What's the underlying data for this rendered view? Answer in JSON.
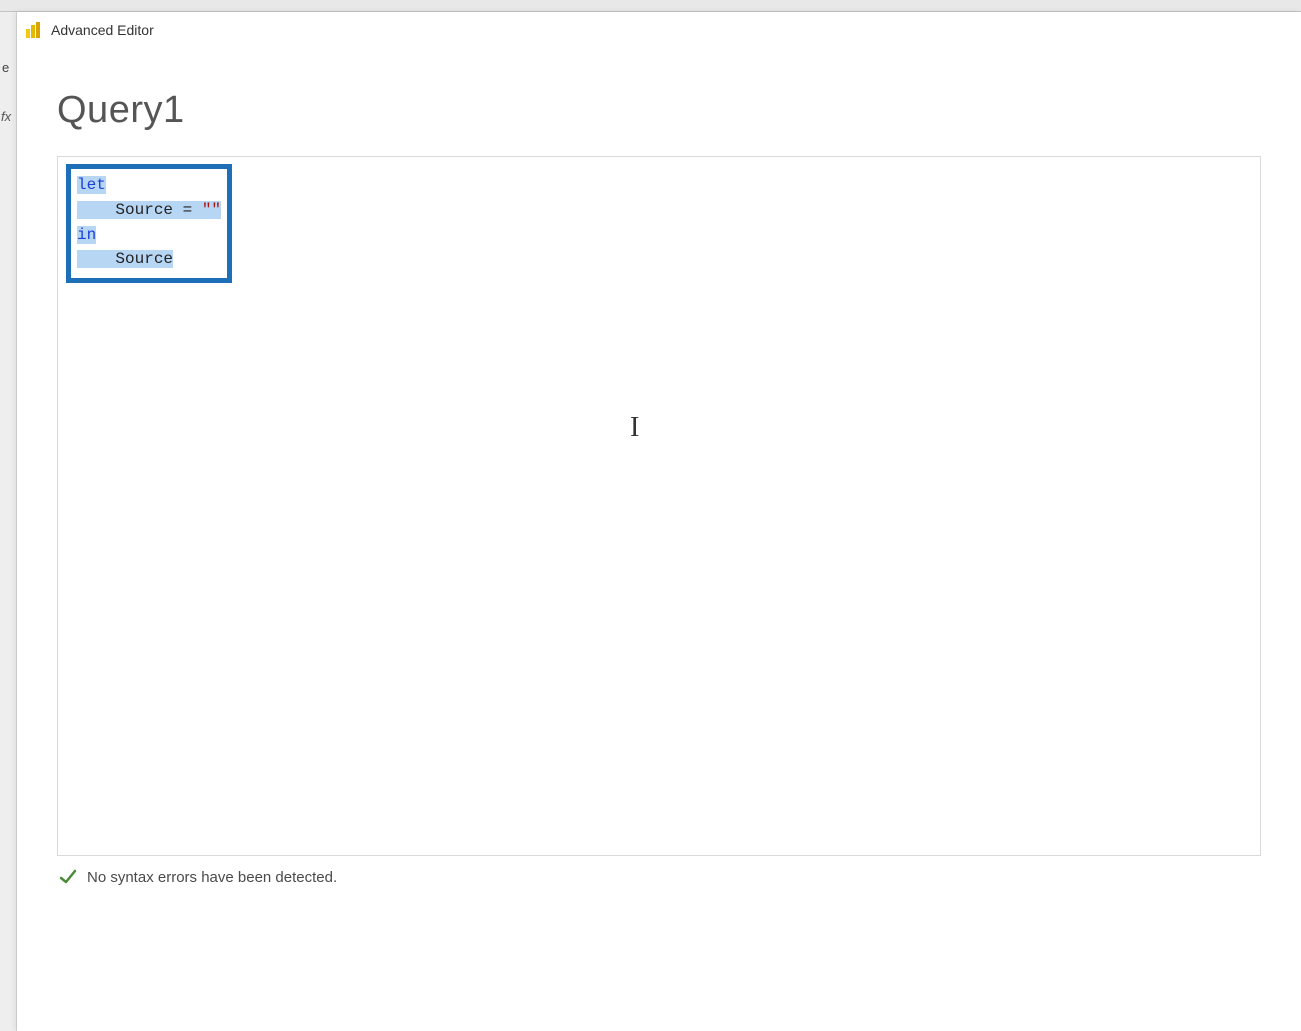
{
  "window": {
    "title": "Advanced Editor"
  },
  "query": {
    "name": "Query1"
  },
  "code": {
    "line1_kw": "let",
    "line2_plain": "    Source = ",
    "line2_str": "\"\"",
    "line3_kw": "in",
    "line4_plain": "    Source"
  },
  "status": {
    "message": "No syntax errors have been detected."
  },
  "cursor": {
    "glyph": "I"
  },
  "backdrop_fragments": {
    "f1": "e",
    "f2": "fx"
  }
}
